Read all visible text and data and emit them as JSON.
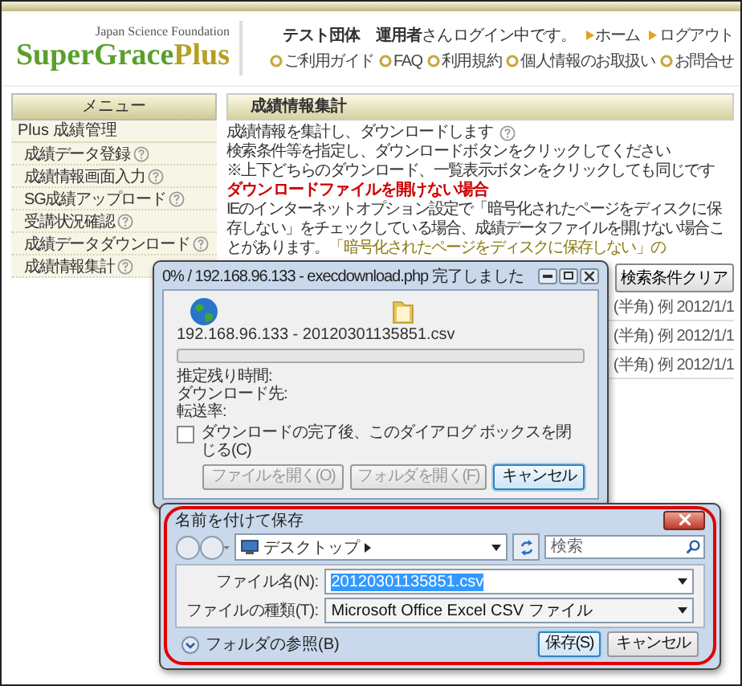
{
  "header": {
    "tagline": "Japan Science Foundation",
    "logo_main": "SuperGrace",
    "logo_suffix": "Plus",
    "login_message": "**テスト団体　運用者**さんログイン中です。",
    "top_links": [
      {
        "label": "ホーム"
      },
      {
        "label": "ログアウト"
      }
    ],
    "nav_links": [
      {
        "label": "ご利用ガイド"
      },
      {
        "label": "FAQ"
      },
      {
        "label": "利用規約"
      },
      {
        "label": "個人情報のお取扱い"
      },
      {
        "label": "お問合せ"
      }
    ]
  },
  "sidebar": {
    "title": "メニュー",
    "section": "Plus 成績管理",
    "items": [
      {
        "label": "成績データ登録"
      },
      {
        "label": "成績情報画面入力"
      },
      {
        "label": "SG成績アップロード"
      },
      {
        "label": "受講状況確認"
      },
      {
        "label": "成績データダウンロード"
      },
      {
        "label": "成績情報集計"
      }
    ]
  },
  "main": {
    "heading": "成績情報集計",
    "intro": "成績情報を集計し、ダウンロードします",
    "instruction": "検索条件等を指定し、ダウンロードボタンをクリックしてください",
    "note": "※上下どちらのダウンロード、一覧表示ボタンをクリックしても同じです",
    "warning_title": "ダウンロードファイルを開けない場合",
    "warning_text": [
      {
        "text": "IEのインターネットオプション設定で「暗号化されたページをディスクに保存しない」をチェックしている場合、成績データファイルを開けない場合ことがあります。",
        "highlight": false
      },
      {
        "text": "「暗号化されたページをディスクに保存しない」の",
        "highlight": true
      }
    ],
    "clear_button": "検索条件クリア",
    "rows": [
      {
        "text": "(半角) 例 2012/1/1"
      },
      {
        "text": "(半角) 例 2012/1/1"
      },
      {
        "text": "(半角) 例 2012/1/1"
      }
    ]
  },
  "download_dialog": {
    "title": "0% / 192.168.96.133 - execdownload.php 完了しました",
    "file": "192.168.96.133 - 20120301135851.csv",
    "level": 0,
    "labels": [
      "推定残り時間:",
      "ダウンロード先:",
      "転送率:"
    ],
    "close_option": {
      "label": "ダウンロードの完了後、このダイアログ ボックスを閉じる(C)",
      "checked": false
    },
    "buttons": [
      {
        "label": "ファイルを開く(O)",
        "disabled": true,
        "focused": false
      },
      {
        "label": "フォルダを開く(F)",
        "disabled": true,
        "focused": false
      },
      {
        "label": "キャンセル",
        "disabled": false,
        "focused": true
      }
    ]
  },
  "save_dialog": {
    "title": "名前を付けて保存",
    "location": "デスクトップ",
    "search": {
      "placeholder": "検索"
    },
    "fields": [
      {
        "kind": "input",
        "label": "ファイル名(N):",
        "value": "20120301135851.csv",
        "text_selected": true
      },
      {
        "kind": "select",
        "label": "ファイルの種類(T):",
        "value": "Microsoft Office Excel CSV ファイル",
        "text_selected": false
      }
    ],
    "folder_toggle": "フォルダの参照(B)",
    "buttons": [
      {
        "label": "保存(S)",
        "focused": true
      },
      {
        "label": "キャンセル",
        "focused": false
      }
    ]
  }
}
